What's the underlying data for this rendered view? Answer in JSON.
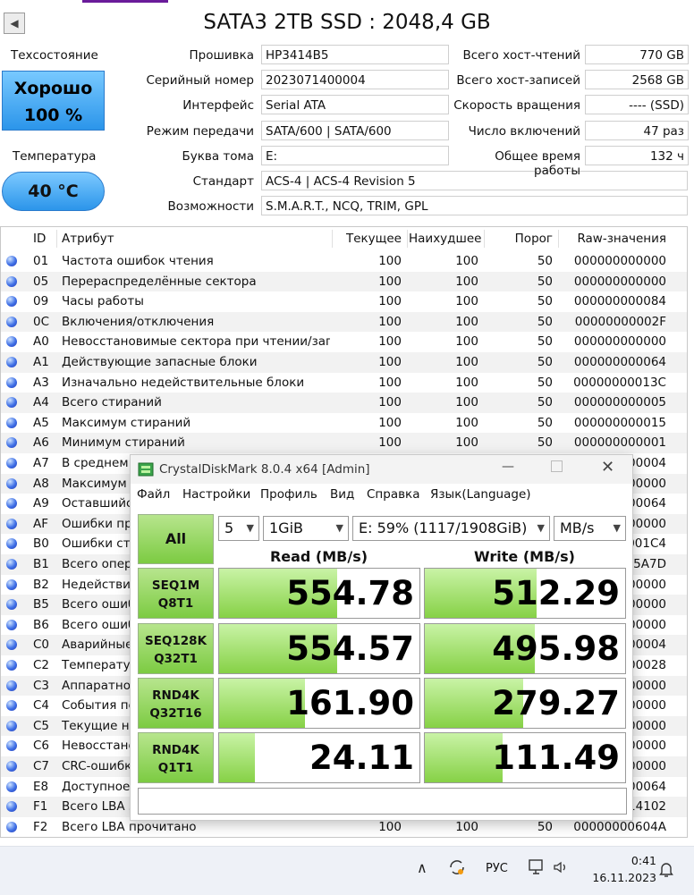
{
  "header": {
    "title": "SATA3 2TB SSD : 2048,4 GB"
  },
  "left_panel": {
    "status_label": "Техсостояние",
    "health_status": "Хорошо",
    "health_percent": "100 %",
    "temp_label": "Температура",
    "temp_value": "40 °C"
  },
  "info_fields": [
    {
      "label": "Прошивка",
      "value": "HP3414B5"
    },
    {
      "label": "Серийный номер",
      "value": "2023071400004"
    },
    {
      "label": "Интерфейс",
      "value": "Serial ATA"
    },
    {
      "label": "Режим передачи",
      "value": "SATA/600 | SATA/600"
    },
    {
      "label": "Буква тома",
      "value": "E:"
    },
    {
      "label": "Стандарт",
      "value": "ACS-4 | ACS-4 Revision 5"
    },
    {
      "label": "Возможности",
      "value": "S.M.A.R.T., NCQ, TRIM, GPL"
    }
  ],
  "right_fields": [
    {
      "label": "Всего хост-чтений",
      "value": "770 GB"
    },
    {
      "label": "Всего хост-записей",
      "value": "2568 GB"
    },
    {
      "label": "Скорость вращения",
      "value": "---- (SSD)"
    },
    {
      "label": "Число включений",
      "value": "47 раз"
    },
    {
      "label": "Общее время работы",
      "value": "132 ч"
    }
  ],
  "table": {
    "columns": [
      "ID",
      "Атрибут",
      "Текущее",
      "Наихудшее",
      "Порог",
      "Raw-значения"
    ],
    "rows": [
      {
        "id": "01",
        "name": "Частота ошибок чтения",
        "cur": "100",
        "worst": "100",
        "thr": "50",
        "raw": "000000000000"
      },
      {
        "id": "05",
        "name": "Перераспределённые сектора",
        "cur": "100",
        "worst": "100",
        "thr": "50",
        "raw": "000000000000"
      },
      {
        "id": "09",
        "name": "Часы работы",
        "cur": "100",
        "worst": "100",
        "thr": "50",
        "raw": "000000000084"
      },
      {
        "id": "0C",
        "name": "Включения/отключения",
        "cur": "100",
        "worst": "100",
        "thr": "50",
        "raw": "00000000002F"
      },
      {
        "id": "A0",
        "name": "Невосстановимые сектора при чтении/зап...",
        "cur": "100",
        "worst": "100",
        "thr": "50",
        "raw": "000000000000"
      },
      {
        "id": "A1",
        "name": "Действующие запасные блоки",
        "cur": "100",
        "worst": "100",
        "thr": "50",
        "raw": "000000000064"
      },
      {
        "id": "A3",
        "name": "Изначально недействительные блоки",
        "cur": "100",
        "worst": "100",
        "thr": "50",
        "raw": "00000000013C"
      },
      {
        "id": "A4",
        "name": "Всего стираний",
        "cur": "100",
        "worst": "100",
        "thr": "50",
        "raw": "000000000005"
      },
      {
        "id": "A5",
        "name": "Максимум стираний",
        "cur": "100",
        "worst": "100",
        "thr": "50",
        "raw": "000000000015"
      },
      {
        "id": "A6",
        "name": "Минимум стираний",
        "cur": "100",
        "worst": "100",
        "thr": "50",
        "raw": "000000000001"
      },
      {
        "id": "A7",
        "name": "В среднем",
        "cur": "",
        "worst": "",
        "thr": "",
        "raw": "00004"
      },
      {
        "id": "A8",
        "name": "Максимум",
        "cur": "",
        "worst": "",
        "thr": "",
        "raw": "00000"
      },
      {
        "id": "A9",
        "name": "Оставшийс",
        "cur": "",
        "worst": "",
        "thr": "",
        "raw": "00064"
      },
      {
        "id": "AF",
        "name": "Ошибки пр",
        "cur": "",
        "worst": "",
        "thr": "",
        "raw": "00000"
      },
      {
        "id": "B0",
        "name": "Ошибки сти",
        "cur": "",
        "worst": "",
        "thr": "",
        "raw": "001C4"
      },
      {
        "id": "B1",
        "name": "Всего опера",
        "cur": "",
        "worst": "",
        "thr": "",
        "raw": "15A7D"
      },
      {
        "id": "B2",
        "name": "Недействит",
        "cur": "",
        "worst": "",
        "thr": "",
        "raw": "00000"
      },
      {
        "id": "B5",
        "name": "Всего ошиб",
        "cur": "",
        "worst": "",
        "thr": "",
        "raw": "00000"
      },
      {
        "id": "B6",
        "name": "Всего ошиб",
        "cur": "",
        "worst": "",
        "thr": "",
        "raw": "00000"
      },
      {
        "id": "C0",
        "name": "Аварийные",
        "cur": "",
        "worst": "",
        "thr": "",
        "raw": "00004"
      },
      {
        "id": "C2",
        "name": "Температур",
        "cur": "",
        "worst": "",
        "thr": "",
        "raw": "00028"
      },
      {
        "id": "C3",
        "name": "Аппаратно",
        "cur": "",
        "worst": "",
        "thr": "",
        "raw": "00000"
      },
      {
        "id": "C4",
        "name": "События пе",
        "cur": "",
        "worst": "",
        "thr": "",
        "raw": "00000"
      },
      {
        "id": "C5",
        "name": "Текущие не",
        "cur": "",
        "worst": "",
        "thr": "",
        "raw": "00000"
      },
      {
        "id": "C6",
        "name": "Невосстано",
        "cur": "",
        "worst": "",
        "thr": "",
        "raw": "00000"
      },
      {
        "id": "C7",
        "name": "CRC-ошибк",
        "cur": "",
        "worst": "",
        "thr": "",
        "raw": "00000"
      },
      {
        "id": "E8",
        "name": "Доступное р",
        "cur": "",
        "worst": "",
        "thr": "",
        "raw": "00064"
      },
      {
        "id": "F1",
        "name": "Всего LBA з",
        "cur": "",
        "worst": "",
        "thr": "",
        "raw": "14102"
      },
      {
        "id": "F2",
        "name": "Всего LBA прочитано",
        "cur": "100",
        "worst": "100",
        "thr": "50",
        "raw": "00000000604A"
      }
    ]
  },
  "cdm": {
    "title": "CrystalDiskMark 8.0.4 x64 [Admin]",
    "menu": [
      "Файл",
      "Настройки",
      "Профиль",
      "Вид",
      "Справка",
      "Язык(Language)"
    ],
    "all_button": "All",
    "count": "5",
    "size": "1GiB",
    "drive": "E: 59% (1117/1908GiB)",
    "unit": "MB/s",
    "read_header": "Read (MB/s)",
    "write_header": "Write (MB/s)",
    "tests": [
      {
        "line1": "SEQ1M",
        "line2": "Q8T1",
        "read": "554.78",
        "write": "512.29",
        "read_fill": 0.59,
        "write_fill": 0.56
      },
      {
        "line1": "SEQ128K",
        "line2": "Q32T1",
        "read": "554.57",
        "write": "495.98",
        "read_fill": 0.59,
        "write_fill": 0.55
      },
      {
        "line1": "RND4K",
        "line2": "Q32T16",
        "read": "161.90",
        "write": "279.27",
        "read_fill": 0.43,
        "write_fill": 0.49
      },
      {
        "line1": "RND4K",
        "line2": "Q1T1",
        "read": "24.11",
        "write": "111.49",
        "read_fill": 0.18,
        "write_fill": 0.39
      }
    ]
  },
  "taskbar": {
    "lang": "РУС",
    "time": "0:41",
    "date": "16.11.2023"
  }
}
